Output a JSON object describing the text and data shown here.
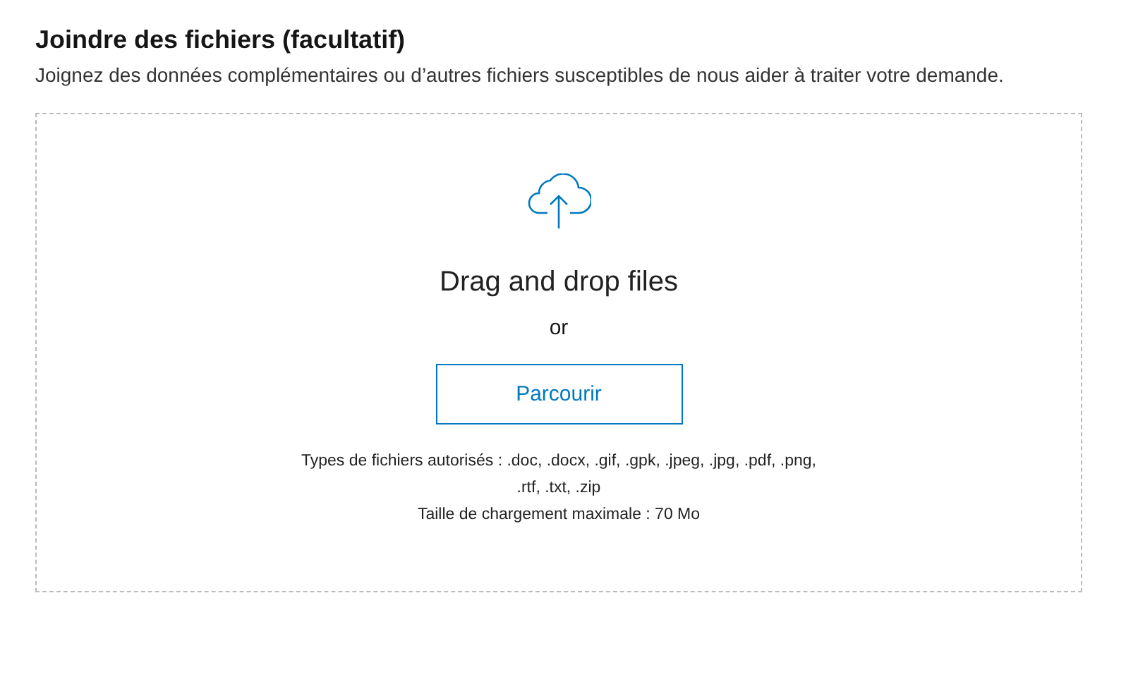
{
  "section": {
    "title": "Joindre des fichiers (facultatif)",
    "description": "Joignez des données complémentaires ou d’autres fichiers susceptibles de nous aider à traiter votre demande."
  },
  "dropzone": {
    "prompt": "Drag and drop files",
    "separator": "or",
    "browse_button": "Parcourir",
    "allowed_types": "Types de fichiers autorisés : .doc, .docx, .gif, .gpk, .jpeg, .jpg, .pdf, .png, .rtf, .txt, .zip",
    "max_size": "Taille de chargement maximale : 70 Mo"
  }
}
